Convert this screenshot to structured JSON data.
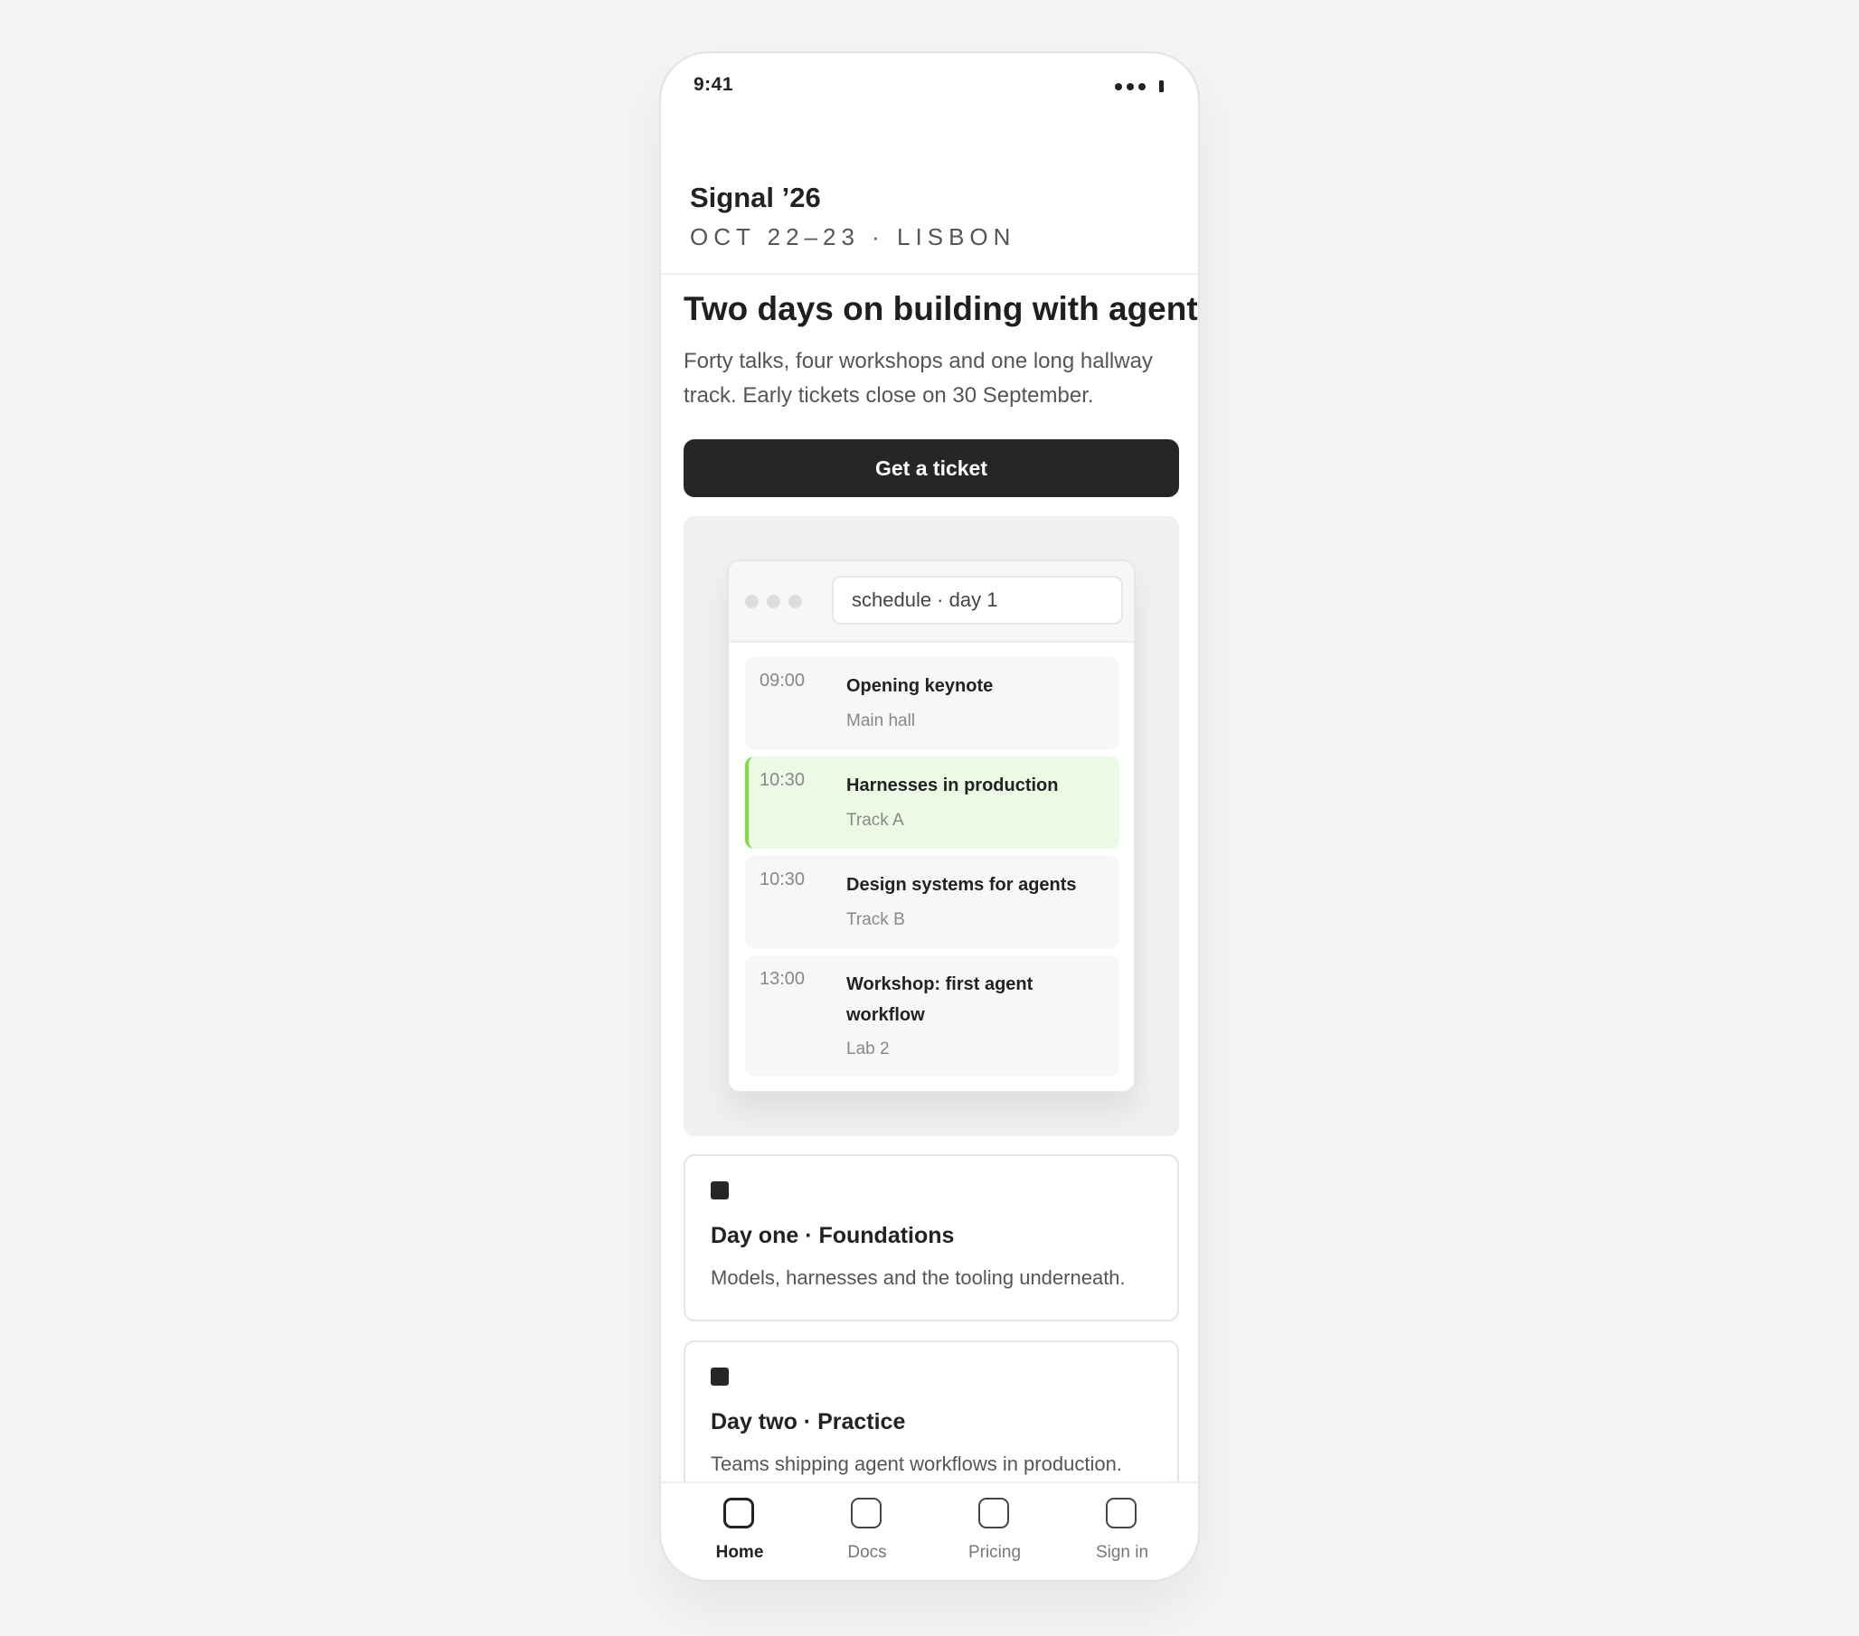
{
  "status_bar": {
    "time": "9:41",
    "signal_icon": "signal-dots-icon",
    "battery_icon": "battery-icon"
  },
  "header": {
    "brand": "Signal ’26",
    "subtitle": "OCT 22–23 · LISBON"
  },
  "hero": {
    "title": "Two days on building with agents",
    "description": "Forty talks, four workshops and one long hallway track. Early tickets close on 30 September.",
    "cta_label": "Get a ticket"
  },
  "schedule": {
    "tab_label": "schedule · day 1",
    "sessions": [
      {
        "time": "09:00",
        "title": "Opening keynote",
        "room": "Main hall",
        "active": false
      },
      {
        "time": "10:30",
        "title": "Harnesses in production",
        "room": "Track A",
        "active": true
      },
      {
        "time": "10:30",
        "title": "Design systems for agents",
        "room": "Track B",
        "active": false
      },
      {
        "time": "13:00",
        "title": "Workshop: first agent workflow",
        "room": "Lab 2",
        "active": false
      }
    ]
  },
  "days": [
    {
      "title": "Day one · Foundations",
      "description": "Models, harnesses and the tooling underneath."
    },
    {
      "title": "Day two · Practice",
      "description": "Teams shipping agent workflows in production."
    }
  ],
  "nav": {
    "items": [
      {
        "label": "Home",
        "active": true
      },
      {
        "label": "Docs",
        "active": false
      },
      {
        "label": "Pricing",
        "active": false
      },
      {
        "label": "Sign in",
        "active": false
      }
    ]
  },
  "colors": {
    "primary": "#262626",
    "accent_green": "#7ddc3f",
    "active_session_bg": "#ecf9e4",
    "page_bg": "#f4f4f4"
  }
}
